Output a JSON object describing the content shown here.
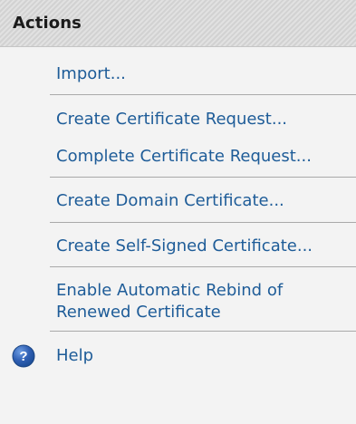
{
  "panel": {
    "title": "Actions"
  },
  "actions": {
    "import": "Import...",
    "create_request": "Create Certificate Request...",
    "complete_request": "Complete Certificate Request...",
    "create_domain": "Create Domain Certificate...",
    "create_self_signed": "Create Self-Signed Certificate...",
    "enable_rebind_line1": "Enable Automatic Rebind of",
    "enable_rebind_line2": "Renewed Certificate",
    "help": "Help"
  },
  "icons": {
    "help": "help-icon"
  },
  "colors": {
    "link": "#1e5c98",
    "help_icon": "#1e4f9a"
  }
}
